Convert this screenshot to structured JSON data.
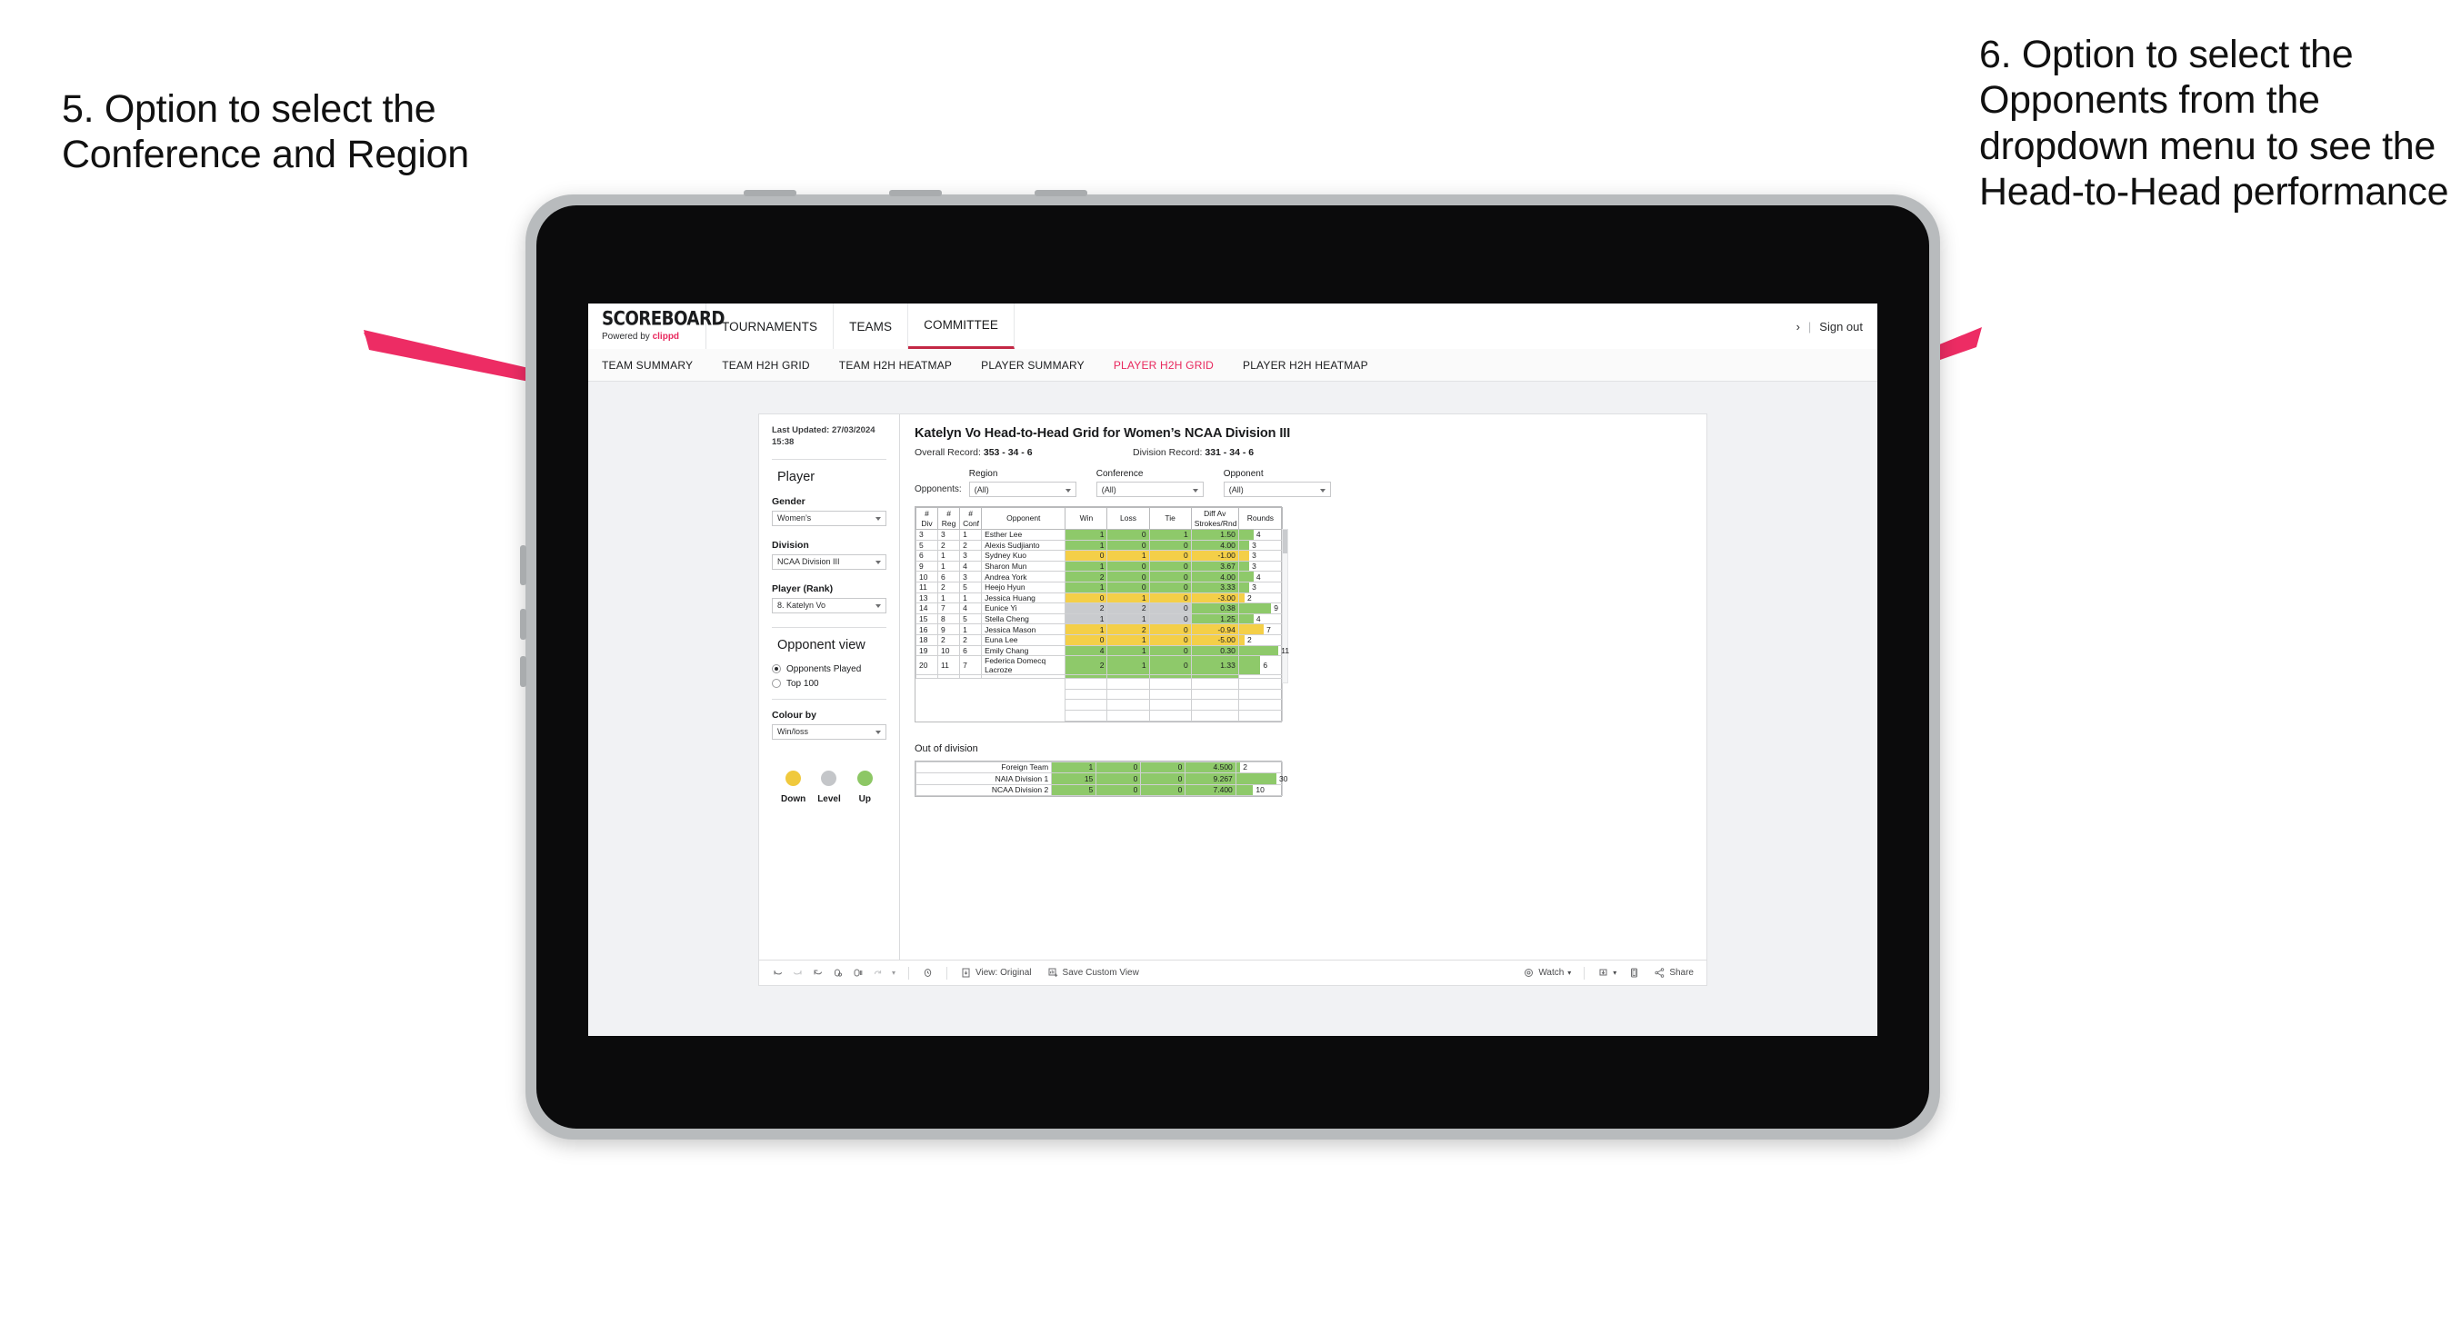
{
  "annotations": {
    "left": "5. Option to select the Conference and Region",
    "right": "6. Option to select the Opponents from the dropdown menu to see the Head-to-Head performance",
    "arrow_color": "#ED2C64"
  },
  "app": {
    "logo_main": "SCOREBOARD",
    "logo_sub_prefix": "Powered by ",
    "logo_sub_brand": "clippd",
    "brand_color": "#e8285d",
    "topnav": [
      {
        "label": "TOURNAMENTS",
        "active": false
      },
      {
        "label": "TEAMS",
        "active": false
      },
      {
        "label": "COMMITTEE",
        "active": true
      }
    ],
    "topnav_right": {
      "chevron": "›",
      "separator": "|",
      "sign_out": "Sign out"
    },
    "subnav": [
      {
        "label": "TEAM SUMMARY",
        "active": false
      },
      {
        "label": "TEAM H2H GRID",
        "active": false
      },
      {
        "label": "TEAM H2H HEATMAP",
        "active": false
      },
      {
        "label": "PLAYER SUMMARY",
        "active": false
      },
      {
        "label": "PLAYER H2H GRID",
        "active": true
      },
      {
        "label": "PLAYER H2H HEATMAP",
        "active": false
      }
    ]
  },
  "sidebar": {
    "last_updated": "Last Updated: 27/03/2024 15:38",
    "player_heading": "Player",
    "fields": [
      {
        "label": "Gender",
        "value": "Women’s"
      },
      {
        "label": "Division",
        "value": "NCAA Division III"
      },
      {
        "label": "Player (Rank)",
        "value": "8. Katelyn Vo"
      }
    ],
    "opponent_view": {
      "heading": "Opponent view",
      "options": [
        {
          "label": "Opponents Played",
          "selected": true
        },
        {
          "label": "Top 100",
          "selected": false
        }
      ]
    },
    "colour_by": {
      "label": "Colour by",
      "value": "Win/loss"
    },
    "legend": [
      {
        "label": "Down",
        "color": "#F0C93D"
      },
      {
        "label": "Level",
        "color": "#C4C6C9"
      },
      {
        "label": "Up",
        "color": "#8DC765"
      }
    ]
  },
  "view": {
    "title": "Katelyn Vo Head-to-Head Grid for Women’s NCAA Division III",
    "overall_record_label": "Overall Record: ",
    "overall_record_value": "353 - 34 - 6",
    "division_record_label": "Division Record: ",
    "division_record_value": "331 -  34 - 6",
    "filters_label": "Opponents:",
    "filters": [
      {
        "label": "Region",
        "value": "(All)"
      },
      {
        "label": "Conference",
        "value": "(All)"
      },
      {
        "label": "Opponent",
        "value": "(All)"
      }
    ]
  },
  "chart_data": {
    "type": "table",
    "title": "Katelyn Vo Head-to-Head Grid for Women’s NCAA Division III",
    "columns": [
      "# Div",
      "# Reg",
      "# Conf",
      "Opponent",
      "Win",
      "Loss",
      "Tie",
      "Diff Av Strokes/Rnd",
      "Rounds"
    ],
    "header_lines": {
      "div": [
        "#",
        "Div"
      ],
      "reg": [
        "#",
        "Reg"
      ],
      "conf": [
        "#",
        "Conf"
      ],
      "opponent": [
        "Opponent"
      ],
      "win": [
        "Win"
      ],
      "loss": [
        "Loss"
      ],
      "tie": [
        "Tie"
      ],
      "diff": [
        "Diff Av",
        "Strokes/Rnd"
      ],
      "rounds": [
        "Rounds"
      ]
    },
    "rows": [
      {
        "div": "3",
        "reg": "3",
        "conf": "1",
        "opponent": "Esther Lee",
        "win": "1",
        "loss": "0",
        "tie": "1",
        "diff": "1.50",
        "rounds": "4",
        "wlt_color": "up",
        "diff_color": "up",
        "rounds_pct": 34
      },
      {
        "div": "5",
        "reg": "2",
        "conf": "2",
        "opponent": "Alexis Sudjianto",
        "win": "1",
        "loss": "0",
        "tie": "0",
        "diff": "4.00",
        "rounds": "3",
        "wlt_color": "up",
        "diff_color": "up",
        "rounds_pct": 24
      },
      {
        "div": "6",
        "reg": "1",
        "conf": "3",
        "opponent": "Sydney Kuo",
        "win": "0",
        "loss": "1",
        "tie": "0",
        "diff": "-1.00",
        "rounds": "3",
        "wlt_color": "down",
        "diff_color": "down",
        "rounds_pct": 24
      },
      {
        "div": "9",
        "reg": "1",
        "conf": "4",
        "opponent": "Sharon Mun",
        "win": "1",
        "loss": "0",
        "tie": "0",
        "diff": "3.67",
        "rounds": "3",
        "wlt_color": "up",
        "diff_color": "up",
        "rounds_pct": 24
      },
      {
        "div": "10",
        "reg": "6",
        "conf": "3",
        "opponent": "Andrea York",
        "win": "2",
        "loss": "0",
        "tie": "0",
        "diff": "4.00",
        "rounds": "4",
        "wlt_color": "up",
        "diff_color": "up",
        "rounds_pct": 34
      },
      {
        "div": "11",
        "reg": "2",
        "conf": "5",
        "opponent": "Heejo Hyun",
        "win": "1",
        "loss": "0",
        "tie": "0",
        "diff": "3.33",
        "rounds": "3",
        "wlt_color": "up",
        "diff_color": "up",
        "rounds_pct": 24
      },
      {
        "div": "13",
        "reg": "1",
        "conf": "1",
        "opponent": "Jessica Huang",
        "win": "0",
        "loss": "1",
        "tie": "0",
        "diff": "-3.00",
        "rounds": "2",
        "wlt_color": "down",
        "diff_color": "down",
        "rounds_pct": 13
      },
      {
        "div": "14",
        "reg": "7",
        "conf": "4",
        "opponent": "Eunice Yi",
        "win": "2",
        "loss": "2",
        "tie": "0",
        "diff": "0.38",
        "rounds": "9",
        "wlt_color": "level",
        "diff_color": "up",
        "rounds_pct": 75
      },
      {
        "div": "15",
        "reg": "8",
        "conf": "5",
        "opponent": "Stella Cheng",
        "win": "1",
        "loss": "1",
        "tie": "0",
        "diff": "1.25",
        "rounds": "4",
        "wlt_color": "level",
        "diff_color": "up",
        "rounds_pct": 34
      },
      {
        "div": "16",
        "reg": "9",
        "conf": "1",
        "opponent": "Jessica Mason",
        "win": "1",
        "loss": "2",
        "tie": "0",
        "diff": "-0.94",
        "rounds": "7",
        "wlt_color": "down",
        "diff_color": "down",
        "rounds_pct": 58
      },
      {
        "div": "18",
        "reg": "2",
        "conf": "2",
        "opponent": "Euna Lee",
        "win": "0",
        "loss": "1",
        "tie": "0",
        "diff": "-5.00",
        "rounds": "2",
        "wlt_color": "down",
        "diff_color": "down",
        "rounds_pct": 13
      },
      {
        "div": "19",
        "reg": "10",
        "conf": "6",
        "opponent": "Emily Chang",
        "win": "4",
        "loss": "1",
        "tie": "0",
        "diff": "0.30",
        "rounds": "11",
        "wlt_color": "up",
        "diff_color": "up",
        "rounds_pct": 92
      },
      {
        "div": "20",
        "reg": "11",
        "conf": "7",
        "opponent": "Federica Domecq Lacroze",
        "win": "2",
        "loss": "1",
        "tie": "0",
        "diff": "1.33",
        "rounds": "6",
        "wlt_color": "up",
        "diff_color": "up",
        "rounds_pct": 50
      }
    ],
    "out_of_division": {
      "title": "Out of division",
      "rows": [
        {
          "name": "Foreign Team",
          "win": "1",
          "loss": "0",
          "tie": "0",
          "diff": "4.500",
          "rounds": "2",
          "wlt_color": "up",
          "diff_color": "up",
          "rounds_pct": 9
        },
        {
          "name": "NAIA Division 1",
          "win": "15",
          "loss": "0",
          "tie": "0",
          "diff": "9.267",
          "rounds": "30",
          "wlt_color": "up",
          "diff_color": "up",
          "rounds_pct": 88
        },
        {
          "name": "NCAA Division 2",
          "win": "5",
          "loss": "0",
          "tie": "0",
          "diff": "7.400",
          "rounds": "10",
          "wlt_color": "up",
          "diff_color": "up",
          "rounds_pct": 37
        }
      ]
    }
  },
  "toolbar": {
    "view_original": "View: Original",
    "save_custom_view": "Save Custom View",
    "watch": "Watch",
    "share": "Share",
    "caret": "▾"
  }
}
